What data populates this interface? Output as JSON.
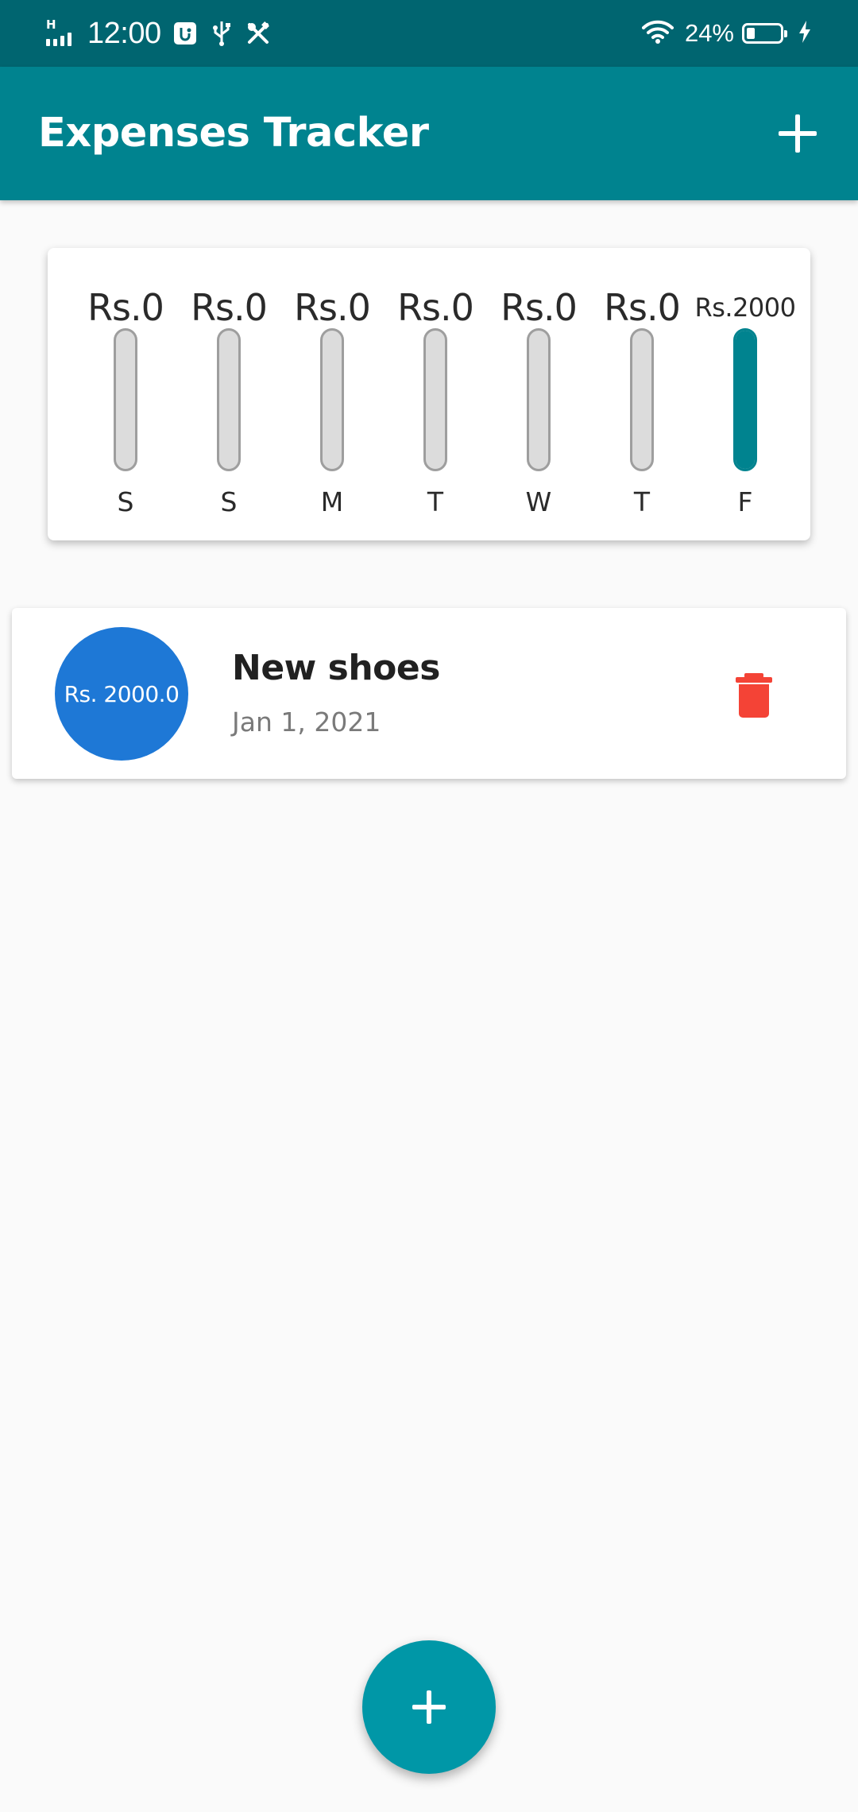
{
  "status_bar": {
    "network_label": "H",
    "time": "12:00",
    "battery_percent": "24%",
    "battery_level": 0.24,
    "icons": [
      "signal-icon",
      "usb-debug-icon",
      "usb-icon",
      "tools-icon",
      "wifi-icon",
      "battery-icon",
      "charging-icon"
    ]
  },
  "app_bar": {
    "title": "Expenses Tracker",
    "add_icon": "plus-icon"
  },
  "chart": {
    "columns": [
      {
        "day": "S",
        "amount": "Rs.0",
        "fill": 0
      },
      {
        "day": "S",
        "amount": "Rs.0",
        "fill": 0
      },
      {
        "day": "M",
        "amount": "Rs.0",
        "fill": 0
      },
      {
        "day": "T",
        "amount": "Rs.0",
        "fill": 0
      },
      {
        "day": "W",
        "amount": "Rs.0",
        "fill": 0
      },
      {
        "day": "T",
        "amount": "Rs.0",
        "fill": 0
      },
      {
        "day": "F",
        "amount": "Rs.2000",
        "fill": 1
      }
    ]
  },
  "transactions": [
    {
      "amount": "Rs. 2000.0",
      "title": "New shoes",
      "date": "Jan 1, 2021",
      "delete_icon": "trash-icon"
    }
  ],
  "fab": {
    "icon": "plus-icon"
  },
  "colors": {
    "status_bar": "#006570",
    "app_bar": "#00838f",
    "bar_fill": "#00838f",
    "bar_empty": "#dcdcdc",
    "avatar": "#1e78d6",
    "delete": "#f44336",
    "fab": "#0097a7",
    "background": "#fafafa"
  }
}
